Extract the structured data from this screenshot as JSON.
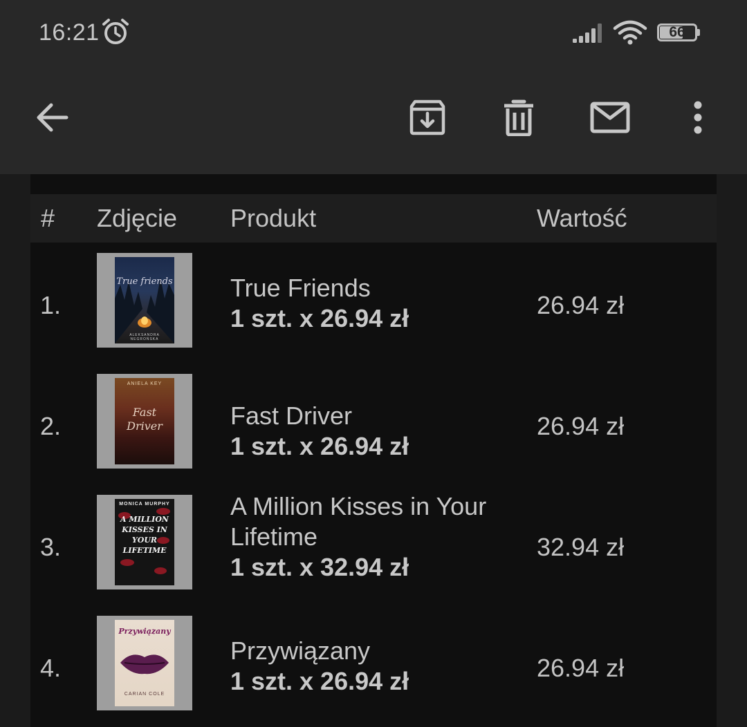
{
  "status_bar": {
    "time": "16:21",
    "battery_level": "66",
    "battery_fraction": 0.66,
    "alarm_icon": "alarm-clock-icon",
    "signal_icon": "cell-signal-icon",
    "wifi_icon": "wifi-icon"
  },
  "app_bar": {
    "back_icon": "arrow-left-icon",
    "archive_icon": "archive-icon",
    "delete_icon": "trash-icon",
    "mail_icon": "mail-icon",
    "more_icon": "more-vertical-icon"
  },
  "table": {
    "headers": {
      "number": "#",
      "photo": "Zdjęcie",
      "product": "Produkt",
      "value": "Wartość"
    },
    "rows": [
      {
        "number": "1.",
        "product_name": "True Friends",
        "quantity_line": "1 szt. x 26.94 zł",
        "value": "26.94 zł",
        "cover_title": "True friends",
        "cover_author": "ALEKSANDRA NEGROŃSKA"
      },
      {
        "number": "2.",
        "product_name": "Fast Driver",
        "quantity_line": "1 szt. x 26.94 zł",
        "value": "26.94 zł",
        "cover_title": "Fast Driver",
        "cover_author": "ANIELA KEY"
      },
      {
        "number": "3.",
        "product_name": "A Million Kisses in Your Lifetime",
        "quantity_line": "1 szt. x 32.94 zł",
        "value": "32.94 zł",
        "cover_title": "A MILLION KISSES IN YOUR LIFETIME",
        "cover_author": "MONICA MURPHY"
      },
      {
        "number": "4.",
        "product_name": "Przywiązany",
        "quantity_line": "1 szt. x 26.94 zł",
        "value": "26.94 zł",
        "cover_title": "Przywiązany",
        "cover_author": "CARIAN COLE"
      }
    ]
  },
  "colors": {
    "app_bar_bg": "#282828",
    "content_bg": "#1b1b1b",
    "card_bg": "#0f0f0f",
    "header_row_bg": "#1e1e1e",
    "text": "#c8c8c8"
  }
}
